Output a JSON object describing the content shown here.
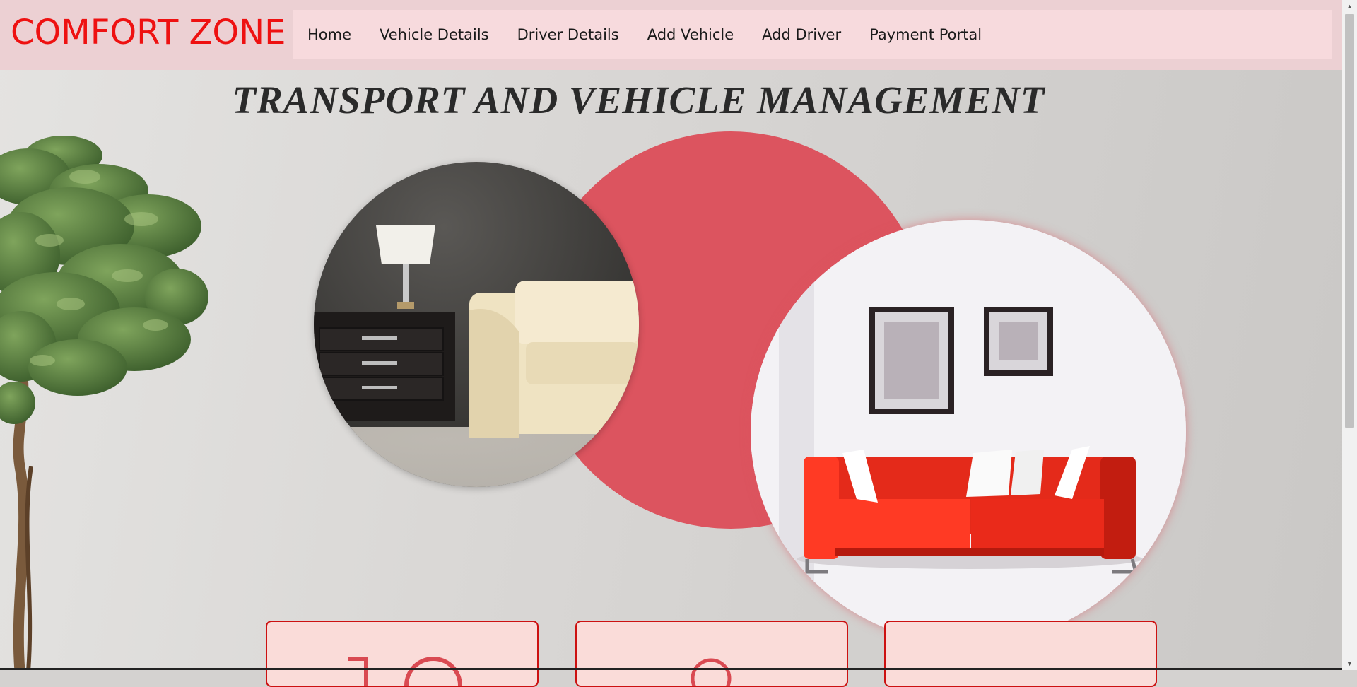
{
  "brand": {
    "name": "COMFORT ZONE"
  },
  "nav": {
    "items": [
      {
        "label": "Home"
      },
      {
        "label": "Vehicle Details"
      },
      {
        "label": "Driver Details"
      },
      {
        "label": "Add Vehicle"
      },
      {
        "label": "Add Driver"
      },
      {
        "label": "Payment Portal"
      }
    ]
  },
  "hero": {
    "title": "TRANSPORT AND VEHICLE MANAGEMENT"
  },
  "colors": {
    "brand": "#ee1111",
    "navbar_bg": "#ecd0d3",
    "nav_panel_bg": "#f7dadd",
    "accent_circle": "#dc545f",
    "card_bg": "#fadcd9",
    "card_border": "#cc1111"
  },
  "icons": {
    "plant": "potted-plant-illustration",
    "left_photo": "dark-room-sofa-lamp-photo",
    "right_photo": "red-sofa-white-room-photo"
  }
}
